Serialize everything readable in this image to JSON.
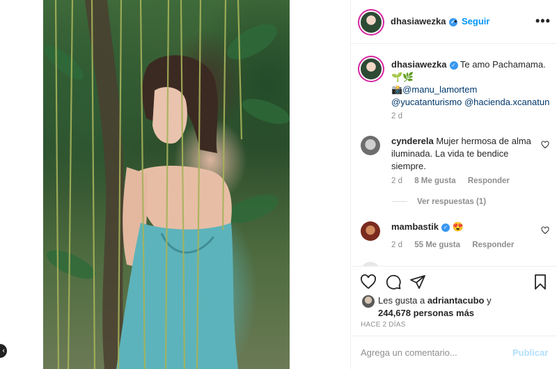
{
  "post": {
    "username": "dhasiawezka",
    "follow_label": "Seguir",
    "separator": "•",
    "more_label": "•••",
    "caption": {
      "text": "Te amo Pachamama.",
      "emoji_line": "🌱🌿",
      "mentions": [
        "📸@manu_lamortem",
        "@yucatanturismo @hacienda.xcanatun"
      ],
      "time": "2 d"
    }
  },
  "comments": [
    {
      "username": "cynderela",
      "text": "Mujer hermosa de alma iluminada. La vida te bendice siempre.",
      "time": "2 d",
      "likes": "8 Me gusta",
      "reply_label": "Responder",
      "view_replies": "Ver respuestas (1)"
    },
    {
      "username": "mambastik",
      "text": "😍",
      "time": "2 d",
      "likes": "55 Me gusta",
      "reply_label": "Responder"
    }
  ],
  "likes": {
    "prefix": "Les gusta a ",
    "user": "adriantacubo",
    "suffix": " y",
    "count": "244,678 personas más"
  },
  "posted_ago": "HACE 2 DÍAS",
  "add_comment": {
    "placeholder": "Agrega un comentario...",
    "publish_label": "Publicar"
  },
  "verified_mark": "✓",
  "nav_arrow": "‹",
  "icons": [
    "like-heart-icon",
    "comment-icon",
    "share-icon",
    "save-bookmark-icon",
    "more-options-icon",
    "verified-badge-icon"
  ],
  "colors": {
    "accent": "#0095f6",
    "verified": "#3897f0",
    "muted": "#8e8e8e",
    "publish_disabled": "#b2dffc"
  }
}
